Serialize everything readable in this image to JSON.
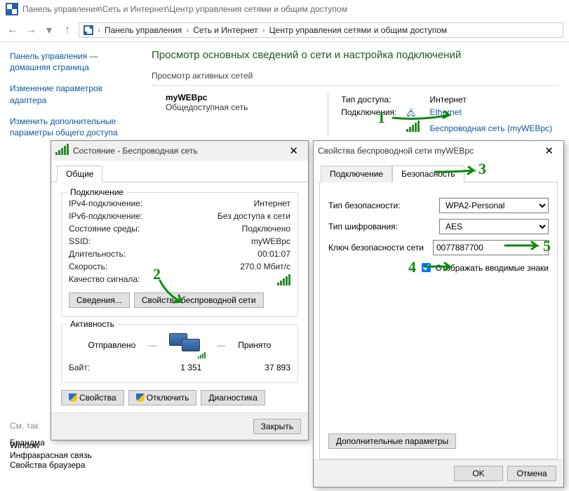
{
  "address_text": "Панель управления\\Сеть и Интернет\\Центр управления сетями и общим доступом",
  "breadcrumbs": {
    "a": "Панель управления",
    "b": "Сеть и Интернет",
    "c": "Центр управления сетями и общим доступом"
  },
  "sidebar": {
    "home": "Панель управления — домашняя страница",
    "adapter": "Изменение параметров адаптера",
    "sharing": "Изменить дополнительные параметры общего доступа"
  },
  "content": {
    "title": "Просмотр основных сведений о сети и настройка подключений",
    "active_label": "Просмотр активных сетей",
    "net_name": "myWEBpc",
    "net_type": "Общедоступная сеть",
    "access_label": "Тип доступа:",
    "access_value": "Интернет",
    "conn_label": "Подключения:",
    "eth": "Ethernet",
    "wifi": "Беспроводная сеть (myWEBpc)"
  },
  "status_dlg": {
    "title": "Состояние - Беспроводная сеть",
    "tab_general": "Общие",
    "grp_conn": "Подключение",
    "ipv4_k": "IPv4-подключение:",
    "ipv4_v": "Интернет",
    "ipv6_k": "IPv6-подключение:",
    "ipv6_v": "Без доступа к сети",
    "medium_k": "Состояние среды:",
    "medium_v": "Подключено",
    "ssid_k": "SSID:",
    "ssid_v": "myWEBpc",
    "dur_k": "Длительность:",
    "dur_v": "00:01:07",
    "speed_k": "Скорость:",
    "speed_v": "270.0 Мбит/с",
    "sig_k": "Качество сигнала:",
    "btn_details": "Сведения...",
    "btn_wprops": "Свойства беспроводной сети",
    "grp_activity": "Активность",
    "sent_lbl": "Отправлено",
    "recv_lbl": "Принято",
    "bytes_lbl": "Байт:",
    "sent_v": "1 351",
    "recv_v": "37 893",
    "btn_props": "Свойства",
    "btn_disable": "Отключить",
    "btn_diag": "Диагностика",
    "btn_close": "Закрыть"
  },
  "props_dlg": {
    "title": "Свойства беспроводной сети myWEBpc",
    "tab_conn": "Подключение",
    "tab_sec": "Безопасность",
    "sectype_lbl": "Тип безопасности:",
    "sectype_val": "WPA2-Personal",
    "enc_lbl": "Тип шифрования:",
    "enc_val": "AES",
    "key_lbl": "Ключ безопасности сети",
    "key_val": "0077887700",
    "show_lbl": "Отображать вводимые знаки",
    "btn_extra": "Дополнительные параметры",
    "btn_ok": "OK",
    "btn_cancel": "Отмена"
  },
  "seealso": {
    "hdr": "См. так",
    "fw": "Брандма",
    "win": "Window",
    "ir": "Инфракрасная связь",
    "browser": "Свойства браузера"
  },
  "anno": {
    "n1": "1",
    "n2": "2",
    "n3": "3",
    "n4": "4",
    "n5": "5"
  }
}
